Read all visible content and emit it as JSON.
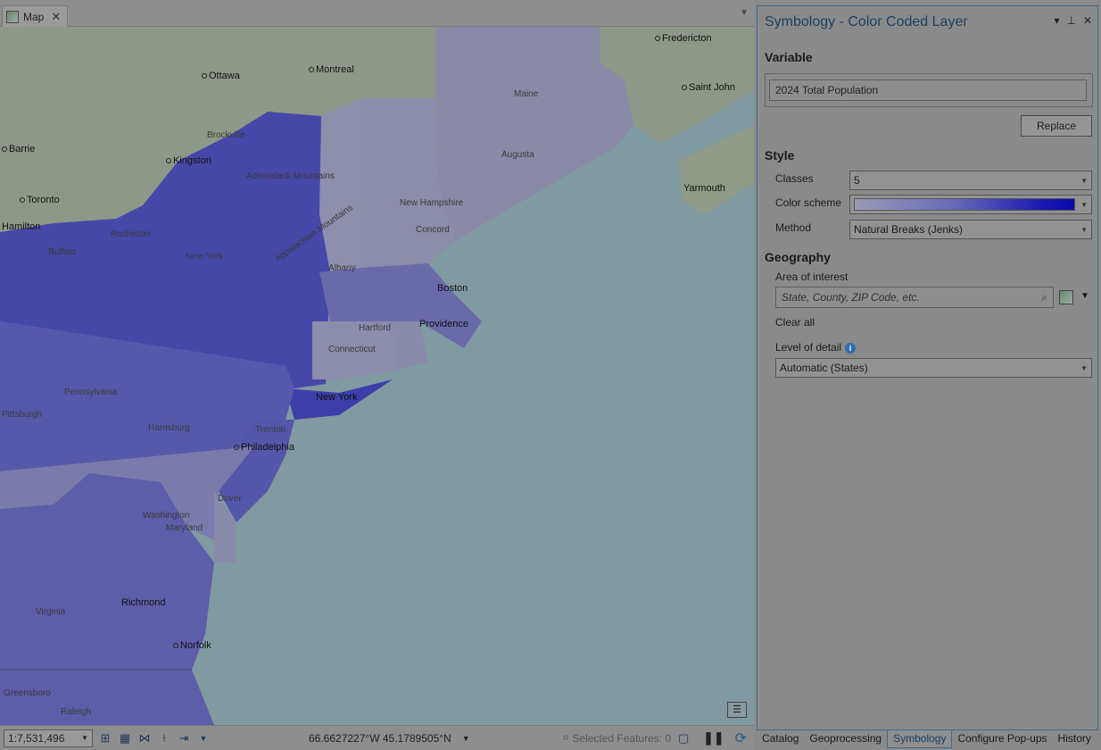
{
  "map_tab": {
    "label": "Map"
  },
  "map_labels": {
    "fredericton": "Fredericton",
    "ottawa": "Ottawa",
    "montreal": "Montreal",
    "saint_john": "Saint John",
    "barrie": "Barrie",
    "kingston": "Kingston",
    "brockville": "Brockville",
    "toronto": "Toronto",
    "hamilton": "Hamilton",
    "rochester": "Rochester",
    "buffalo": "Buffalo",
    "yarmouth": "Yarmouth",
    "augusta": "Augusta",
    "maine": "Maine",
    "concord": "Concord",
    "albany": "Albany",
    "new_york_state": "New York",
    "adirondack": "Adirondack Mountains",
    "appalachian": "Appalachian Mountains",
    "new_hampshire": "New Hampshire",
    "boston": "Boston",
    "hartford": "Hartford",
    "providence": "Providence",
    "connecticut": "Connecticut",
    "new_york_city": "New York",
    "pennsylvania": "Pennsylvania",
    "pittsburgh": "Pittsburgh",
    "harrisburg": "Harrisburg",
    "trenton": "Trenton",
    "philadelphia": "Philadelphia",
    "dover": "Dover",
    "washington": "Washington",
    "maryland": "Maryland",
    "richmond": "Richmond",
    "virginia": "Virginia",
    "norfolk": "Norfolk",
    "greensboro": "Greensboro",
    "raleigh": "Raleigh"
  },
  "statusbar": {
    "scale": "1:7,531,496",
    "coordinates": "66.6627227°W 45.1789505°N",
    "selected_features": "Selected Features: 0"
  },
  "panel": {
    "title": "Symbology - Color Coded Layer",
    "variable_heading": "Variable",
    "variable_value": "2024 Total Population",
    "replace_label": "Replace",
    "style_heading": "Style",
    "classes_label": "Classes",
    "classes_value": "5",
    "color_scheme_label": "Color scheme",
    "method_label": "Method",
    "method_value": "Natural Breaks (Jenks)",
    "geography_heading": "Geography",
    "area_label": "Area of interest",
    "area_placeholder": "State, County, ZIP Code, etc.",
    "clear_all_label": "Clear all",
    "level_label": "Level of detail",
    "level_value": "Automatic (States)"
  },
  "bottom_tabs": [
    "Catalog",
    "Geoprocessing",
    "Symbology",
    "Configure Pop-ups",
    "History"
  ],
  "colors": {
    "accent": "#3d6b8e",
    "ramp_dark": "#0a0aa8",
    "ramp_light": "#9a9ab4"
  }
}
